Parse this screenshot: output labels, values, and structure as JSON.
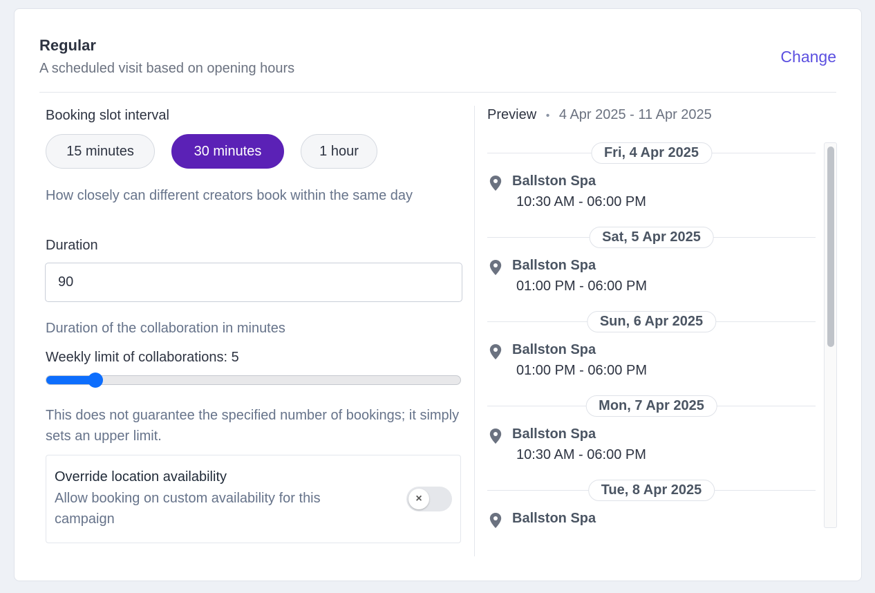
{
  "header": {
    "title": "Regular",
    "subtitle": "A scheduled visit based on opening hours",
    "change_label": "Change"
  },
  "slot_interval": {
    "label": "Booking slot interval",
    "options": [
      "15 minutes",
      "30 minutes",
      "1 hour"
    ],
    "selected": "30 minutes",
    "help": "How closely can different creators book within the same day"
  },
  "duration": {
    "label": "Duration",
    "value": "90",
    "help": "Duration of the collaboration in minutes"
  },
  "weekly_limit": {
    "label": "Weekly limit of collaborations: 5",
    "value": 5,
    "fraction": 0.12,
    "help": "This does not guarantee the specified number of bookings; it simply sets an upper limit."
  },
  "override": {
    "title": "Override location availability",
    "description": "Allow booking on custom availability for this campaign",
    "enabled": false,
    "knob_icon": "×"
  },
  "preview": {
    "label": "Preview",
    "separator": "•",
    "range": "4 Apr 2025 - 11 Apr 2025",
    "days": [
      {
        "date": "Fri, 4 Apr 2025",
        "location": "Ballston Spa",
        "hours": "10:30 AM - 06:00 PM"
      },
      {
        "date": "Sat, 5 Apr 2025",
        "location": "Ballston Spa",
        "hours": "01:00 PM - 06:00 PM"
      },
      {
        "date": "Sun, 6 Apr 2025",
        "location": "Ballston Spa",
        "hours": "01:00 PM - 06:00 PM"
      },
      {
        "date": "Mon, 7 Apr 2025",
        "location": "Ballston Spa",
        "hours": "10:30 AM - 06:00 PM"
      },
      {
        "date": "Tue, 8 Apr 2025",
        "location": "Ballston Spa",
        "hours": ""
      }
    ]
  },
  "colors": {
    "accent": "#5b21b6",
    "link": "#5b4fe0",
    "slider": "#0d6efd"
  }
}
